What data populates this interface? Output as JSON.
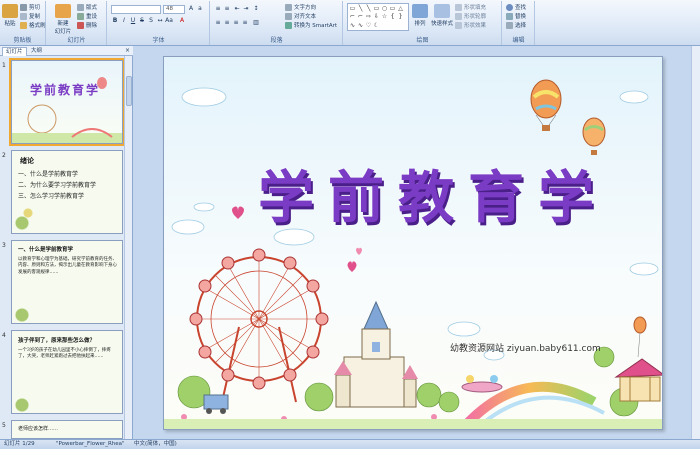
{
  "ribbon": {
    "clipboard": {
      "label": "剪贴板",
      "paste": "粘贴",
      "cut": "剪切",
      "copy": "复制",
      "format_painter": "格式刷"
    },
    "slides": {
      "label": "幻灯片",
      "new_slide": "新建\n幻灯片",
      "layout": "版式",
      "reset": "重设",
      "delete": "删除"
    },
    "font": {
      "label": "字体",
      "size": "48"
    },
    "paragraph": {
      "label": "段落",
      "text_direction": "文字方向",
      "align_text": "对齐文本",
      "smartart": "转换为 SmartArt"
    },
    "drawing": {
      "label": "绘图",
      "arrange": "排列",
      "quick_styles": "快速样式",
      "shape_fill": "形状填充",
      "shape_outline": "形状轮廓",
      "shape_effects": "形状效果"
    },
    "editing": {
      "label": "编辑",
      "find": "查找",
      "replace": "替换",
      "select": "选择"
    }
  },
  "panel": {
    "tab_slides": "幻灯片",
    "tab_outline": "大纲",
    "close": "×",
    "thumbs": [
      {
        "num": "1",
        "title": "学前教育学"
      },
      {
        "num": "2",
        "heading": "绪论",
        "lines": [
          "一、什么是学前教育学",
          "二、为什么要学习学前教育学",
          "三、怎么学习学前教育学"
        ]
      },
      {
        "num": "3",
        "heading": "一、什么是学前教育学",
        "body": "以教育学和心理学为基础，研究学前教育的任务、内容、原则和方法，揭示出儿童在教育影响下身心发展的客观规律……"
      },
      {
        "num": "4",
        "heading": "孩子伴到了，原来那些怎么做？",
        "body": "一个3岁的孩子在幼儿园里不小心摔倒了，摔疼了，大哭，老师赶紧跑过去把他扶起来……"
      },
      {
        "num": "5",
        "body": "老师应该怎样……"
      }
    ]
  },
  "slide": {
    "title": "学前教育学",
    "watermark": "幼教资源网站  ziyuan.baby611.com"
  },
  "statusbar": {
    "slide_info": "幻灯片 1/29",
    "theme": "\"Powerbar_Flower_Rhea\"",
    "language": "中文(简体，中国)"
  },
  "colors": {
    "title_purple": "#7a3cc4",
    "ribbon_bg": "#dbe7f6",
    "selection": "#f0a830"
  }
}
